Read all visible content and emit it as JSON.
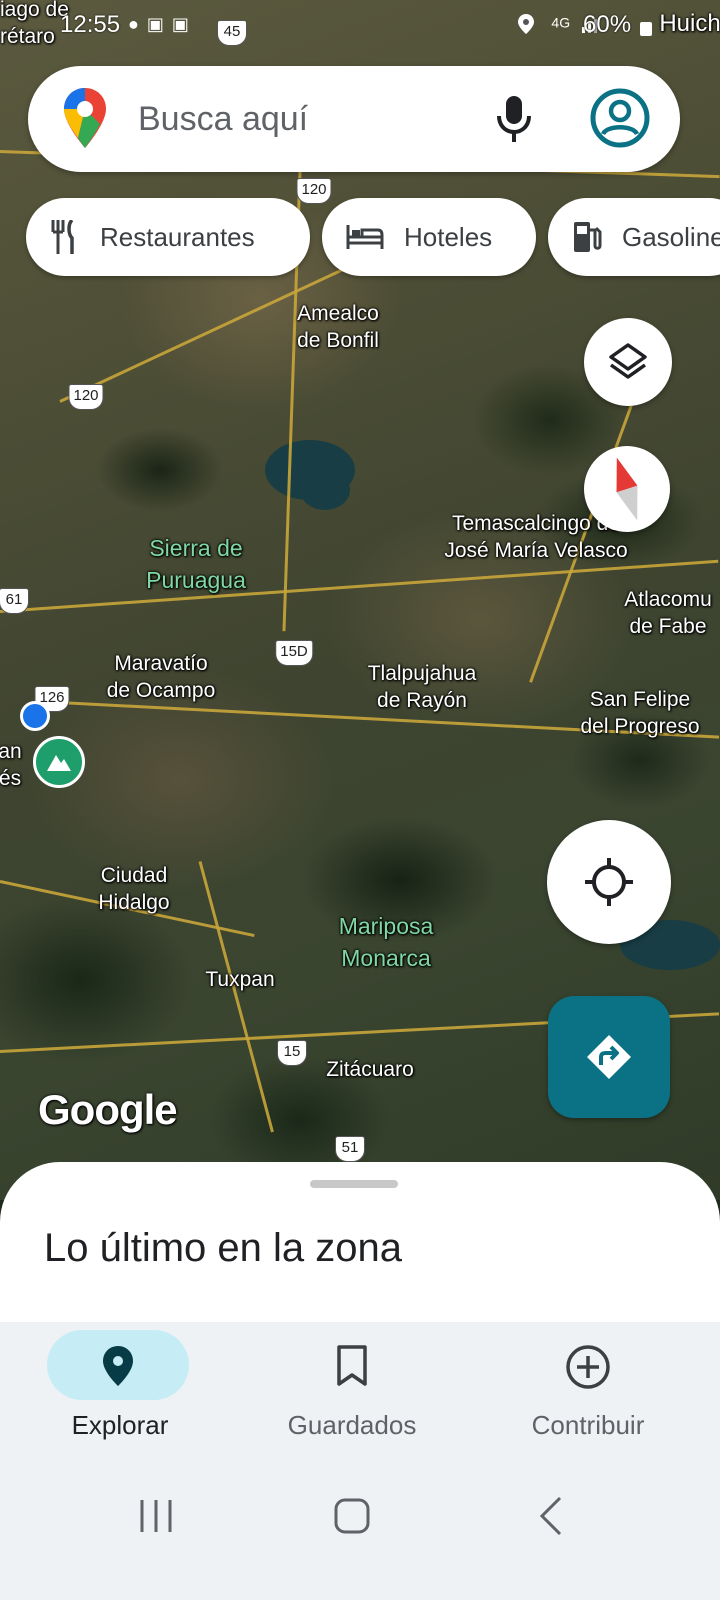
{
  "status_bar": {
    "time": "12:55",
    "battery": "60%",
    "network": "4G",
    "notification_icons": [
      "chat-icon",
      "calendar-icon",
      "calendar-icon"
    ]
  },
  "search": {
    "placeholder": "Busca aquí"
  },
  "chips": [
    {
      "label": "Restaurantes",
      "icon": "restaurant-icon"
    },
    {
      "label": "Hoteles",
      "icon": "hotel-icon"
    },
    {
      "label": "Gasolineras",
      "icon": "gas-station-icon"
    }
  ],
  "map": {
    "labels": {
      "corner_top_left": "iago de\nrétaro",
      "corner_top_right": "Huich",
      "amealco": "Amealco\nde Bonfil",
      "sierra": "Sierra de\nPuruagua",
      "temascalcingo": "Temascalcingo de\nJosé María Velasco",
      "atlacomulco": "Atlacomu\nde Fabe",
      "maravatio": "Maravatío\nde Ocampo",
      "tlalpujahua": "Tlalpujahua\nde Rayón",
      "san_felipe": "San Felipe\ndel Progreso",
      "left_edge": "an\nés",
      "ciudad_hidalgo": "Ciudad\nHidalgo",
      "mariposa": "Mariposa\nMonarca",
      "tuxpan": "Tuxpan",
      "zitacuaro": "Zitácuaro"
    },
    "highway_shields": {
      "s45": "45",
      "s120a": "120",
      "s120b": "120",
      "s61": "61",
      "s15d": "15D",
      "s126": "126",
      "s15": "15",
      "s51": "51"
    },
    "watermark": "Google"
  },
  "bottom_sheet": {
    "title": "Lo último en la zona"
  },
  "bottom_nav": [
    {
      "label": "Explorar",
      "icon": "explore-pin-icon",
      "active": true
    },
    {
      "label": "Guardados",
      "icon": "bookmark-icon",
      "active": false
    },
    {
      "label": "Contribuir",
      "icon": "add-circle-icon",
      "active": false
    }
  ],
  "colors": {
    "accent": "#0b7285",
    "nav_active_pill": "#c6ecf6",
    "nav_background": "#eef2f4"
  }
}
